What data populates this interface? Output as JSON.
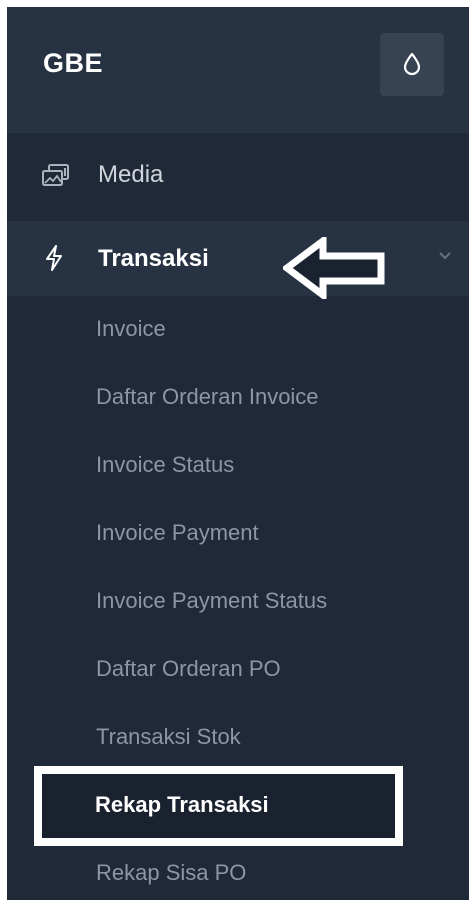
{
  "brand": {
    "title": "GBE"
  },
  "theme_toggle": {
    "icon": "droplet-icon"
  },
  "nav": {
    "media": {
      "label": "Media",
      "icon": "media-gallery-icon"
    },
    "transaksi": {
      "label": "Transaksi",
      "icon": "lightning-icon",
      "expanded": true
    }
  },
  "submenu": [
    {
      "label": "Invoice"
    },
    {
      "label": "Daftar Orderan Invoice"
    },
    {
      "label": "Invoice Status"
    },
    {
      "label": "Invoice Payment"
    },
    {
      "label": "Invoice Payment Status"
    },
    {
      "label": "Daftar Orderan PO"
    },
    {
      "label": "Transaksi Stok"
    },
    {
      "label": "Rekap Transaksi",
      "active": true
    },
    {
      "label": "Rekap Sisa PO"
    }
  ],
  "colors": {
    "sidebar_bg": "#1f2937",
    "header_bg": "#273242",
    "active_text": "#ffffff",
    "muted_text": "#8d96a3",
    "annotation": "#ffffff"
  }
}
